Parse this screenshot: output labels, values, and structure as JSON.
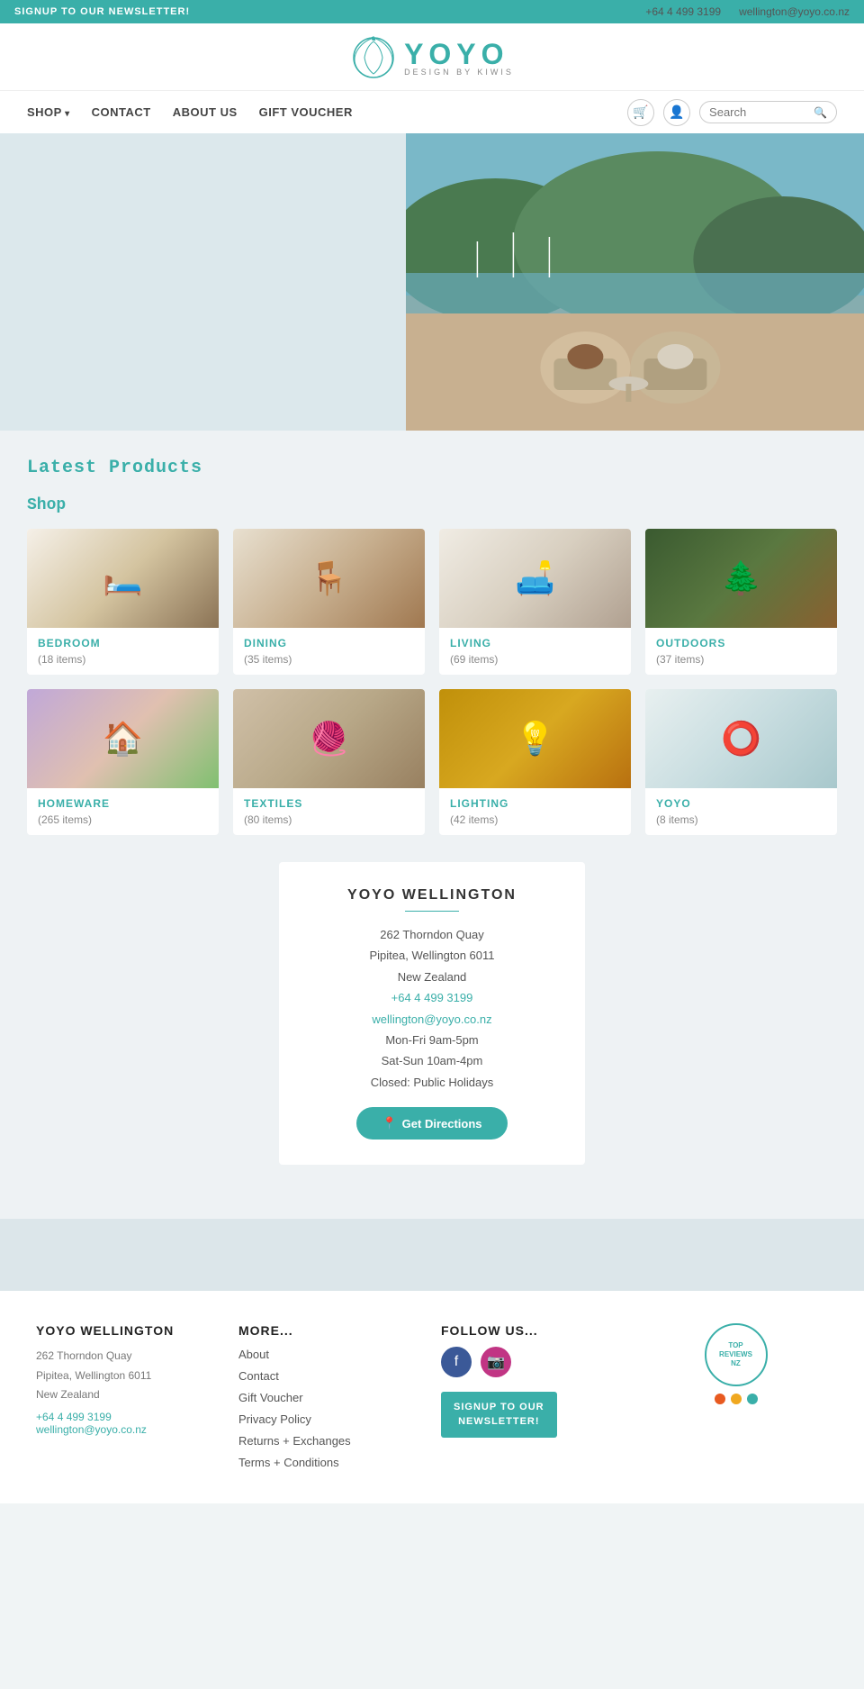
{
  "topbar": {
    "newsletter_label": "SIGNUP TO OUR NEWSLETTER!",
    "phone": "+64 4 499 3199",
    "email": "wellington@yoyo.co.nz"
  },
  "header": {
    "logo_name": "YOYO",
    "logo_sub": "DESIGN BY KIWIS"
  },
  "nav": {
    "links": [
      {
        "label": "SHOP",
        "has_arrow": true
      },
      {
        "label": "CONTACT",
        "has_arrow": false
      },
      {
        "label": "ABOUT US",
        "has_arrow": false
      },
      {
        "label": "GIFT VOUCHER",
        "has_arrow": false
      }
    ],
    "search_placeholder": "Search"
  },
  "sections": {
    "latest_products_title": "Latest Products",
    "shop_title": "Shop"
  },
  "products": [
    {
      "name": "BEDROOM",
      "count": "(18 items)",
      "emoji": "🛏️",
      "bg": "bg-bedroom"
    },
    {
      "name": "DINING",
      "count": "(35 items)",
      "emoji": "🪑",
      "bg": "bg-dining"
    },
    {
      "name": "LIVING",
      "count": "(69 items)",
      "emoji": "🛋️",
      "bg": "bg-living"
    },
    {
      "name": "OUTDOORS",
      "count": "(37 items)",
      "emoji": "🌲",
      "bg": "bg-outdoors"
    },
    {
      "name": "HOMEWARE",
      "count": "(265 items)",
      "emoji": "🏠",
      "bg": "bg-homeware"
    },
    {
      "name": "TEXTILES",
      "count": "(80 items)",
      "emoji": "🧶",
      "bg": "bg-textiles"
    },
    {
      "name": "LIGHTING",
      "count": "(42 items)",
      "emoji": "💡",
      "bg": "bg-lighting"
    },
    {
      "name": "YOYO",
      "count": "(8 items)",
      "emoji": "⭕",
      "bg": "bg-yoyo"
    }
  ],
  "store": {
    "name": "YOYO WELLINGTON",
    "address_line1": "262 Thorndon Quay",
    "address_line2": "Pipitea, Wellington 6011",
    "address_line3": "New Zealand",
    "phone": "+64 4 499 3199",
    "email": "wellington@yoyo.co.nz",
    "hours_weekday": "Mon-Fri 9am-5pm",
    "hours_weekend": "Sat-Sun 10am-4pm",
    "hours_holidays": "Closed: Public Holidays",
    "directions_label": "Get Directions"
  },
  "footer": {
    "col1_title": "YOYO WELLINGTON",
    "col1_address1": "262 Thorndon Quay",
    "col1_address2": "Pipitea, Wellington 6011",
    "col1_address3": "New Zealand",
    "col1_phone": "+64 4 499 3199",
    "col1_email": "wellington@yoyo.co.nz",
    "col2_title": "More...",
    "col2_links": [
      {
        "label": "About"
      },
      {
        "label": "Contact"
      },
      {
        "label": "Gift Voucher"
      },
      {
        "label": "Privacy Policy"
      },
      {
        "label": "Returns + Exchanges"
      },
      {
        "label": "Terms + Conditions"
      }
    ],
    "col3_title": "Follow us...",
    "newsletter_label": "SIGNUP TO OUR\nNEWSLETTER!",
    "badge_text": "TOP\nREVIEWS\nNZ"
  }
}
